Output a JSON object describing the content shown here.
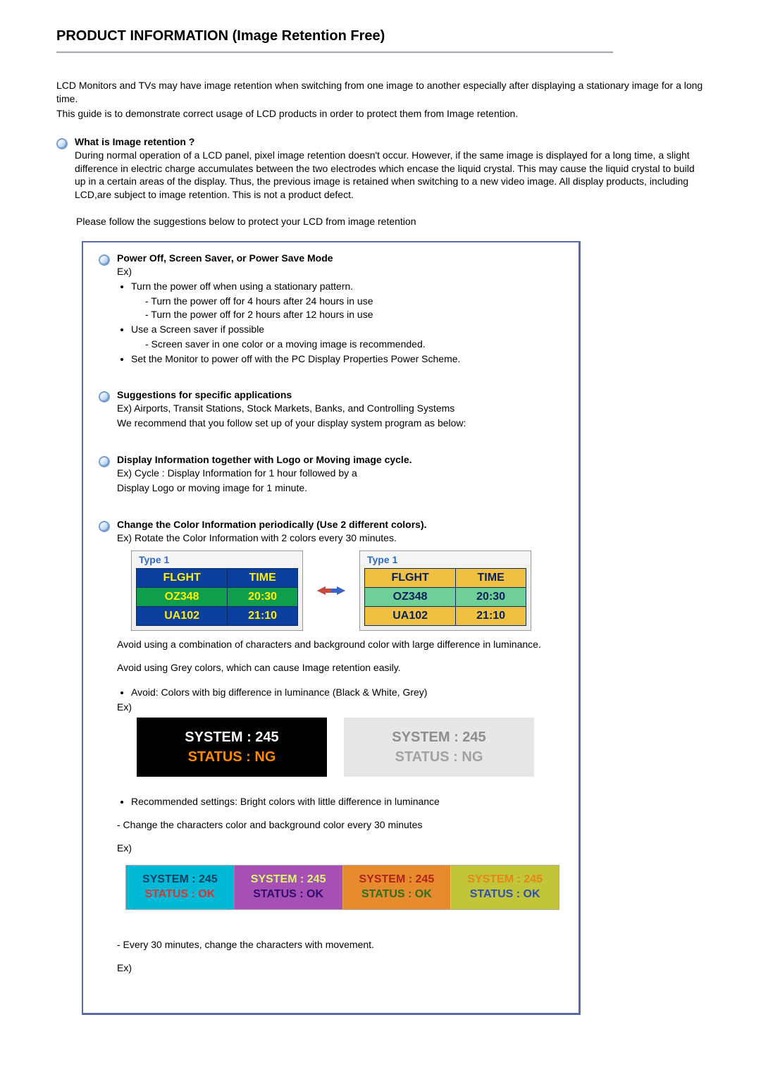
{
  "title": "PRODUCT INFORMATION (Image Retention Free)",
  "intro": {
    "p1": "LCD Monitors and TVs may have image retention when switching from one image to another especially after displaying a stationary image for a long time.",
    "p2": "This guide is to demonstrate correct usage of LCD products in order to protect them from Image retention."
  },
  "s1": {
    "heading": "What is Image retention ?",
    "body": "During normal operation of a LCD panel, pixel image retention doesn't occur. However, if the same image is displayed for a long time, a slight difference in electric charge accumulates between the two electrodes which encase the liquid crystal. This may cause the liquid crystal to build up in a certain areas of the display. Thus, the previous image is retained when switching to a new video image. All display products, including LCD,are subject to image retention. This is not a product defect.",
    "follow": "Please follow the suggestions below to protect your LCD from image retention"
  },
  "box": {
    "a": {
      "heading": "Power Off, Screen Saver, or Power Save Mode",
      "ex": "Ex)",
      "li1": "Turn the power off when using a stationary pattern.",
      "li1a": "- Turn the power off for 4 hours after 24 hours in use",
      "li1b": "- Turn the power off for 2 hours after 12 hours in use",
      "li2": "Use a Screen saver if possible",
      "li2a": "- Screen saver in one color or a moving image is recommended.",
      "li3": "Set the Monitor to power off with the PC Display Properties Power Scheme."
    },
    "b": {
      "heading": "Suggestions for specific applications",
      "l1": "Ex) Airports, Transit Stations, Stock Markets, Banks, and Controlling Systems",
      "l2": "We recommend that you follow set up of your display system program as below:"
    },
    "c": {
      "heading": "Display Information together with Logo or Moving image cycle.",
      "l1": "Ex) Cycle : Display Information for 1 hour followed by a",
      "l2": "Display Logo or moving image for 1 minute."
    },
    "d": {
      "heading": "Change the Color Information periodically (Use 2 different colors).",
      "l1": "Ex) Rotate the Color Information with 2 colors every 30 minutes."
    },
    "fb": {
      "type": "Type 1",
      "h1": "FLGHT",
      "h2": "TIME",
      "r1c1": "OZ348",
      "r1c2": "20:30",
      "r2c1": "UA102",
      "r2c2": "21:10"
    },
    "afterfig": {
      "l1": "Avoid using a combination of characters and background color with large difference in luminance.",
      "l2": "Avoid using Grey colors, which can cause Image retention easily."
    },
    "avoid": {
      "li": "Avoid: Colors with big difference in luminance (Black & White, Grey)",
      "ex": "Ex)",
      "sys": "SYSTEM : 245",
      "status": "STATUS : NG"
    },
    "rec": {
      "li": "Recommended settings: Bright colors with little difference in luminance",
      "l1": "- Change the characters color and background color every 30 minutes",
      "ex": "Ex)",
      "sys": "SYSTEM : 245",
      "status": "STATUS : OK"
    },
    "last": {
      "l1": "- Every 30 minutes, change the characters with movement.",
      "ex": "Ex)"
    }
  }
}
